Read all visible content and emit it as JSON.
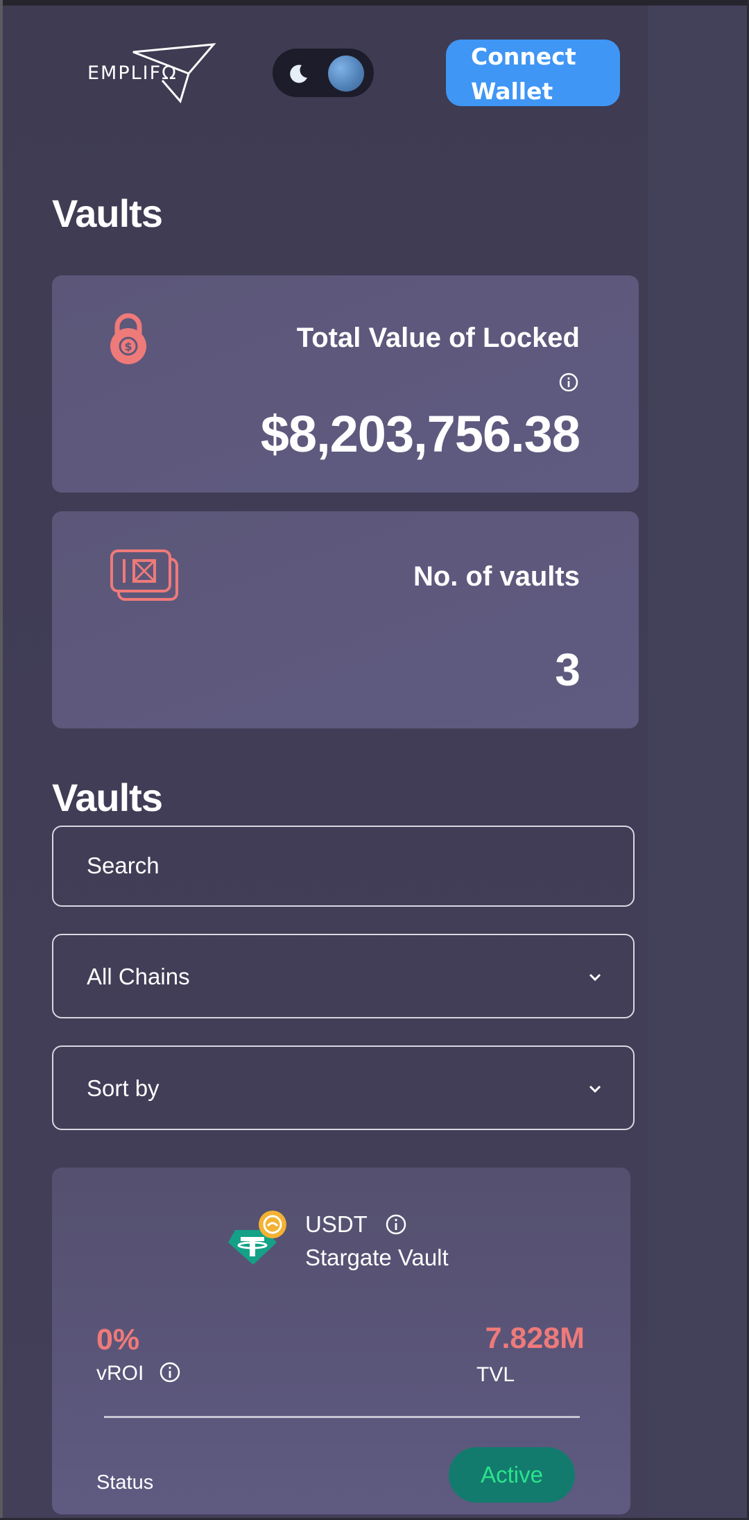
{
  "header": {
    "logo_text": "EMPLIFΩ",
    "theme_toggle": {
      "state": "dark",
      "icon": "moon-icon"
    },
    "connect_button": "Connect\nWallet"
  },
  "summary": {
    "title": "Vaults",
    "tvl_card": {
      "icon": "lock-dollar-icon",
      "label": "Total Value of Locked",
      "value": "$8,203,756.38"
    },
    "vaults_card": {
      "icon": "vault-stack-icon",
      "label": "No. of vaults",
      "value": "3"
    }
  },
  "vaults": {
    "title": "Vaults",
    "search": {
      "placeholder": "Search"
    },
    "chain_filter": {
      "selected": "All Chains"
    },
    "sort": {
      "selected": "Sort by"
    },
    "items": [
      {
        "token": "USDT",
        "name": "Stargate Vault",
        "vroi_value": "0%",
        "vroi_label": "vROI",
        "tvl_value": "7.828M",
        "tvl_label": "TVL",
        "status_label": "Status",
        "status": "Active"
      }
    ]
  },
  "colors": {
    "accent_blue": "#3f96f5",
    "metric_red": "#ef7a7a",
    "status_green": "#2be38c",
    "card_bg": "#5e5a81"
  }
}
